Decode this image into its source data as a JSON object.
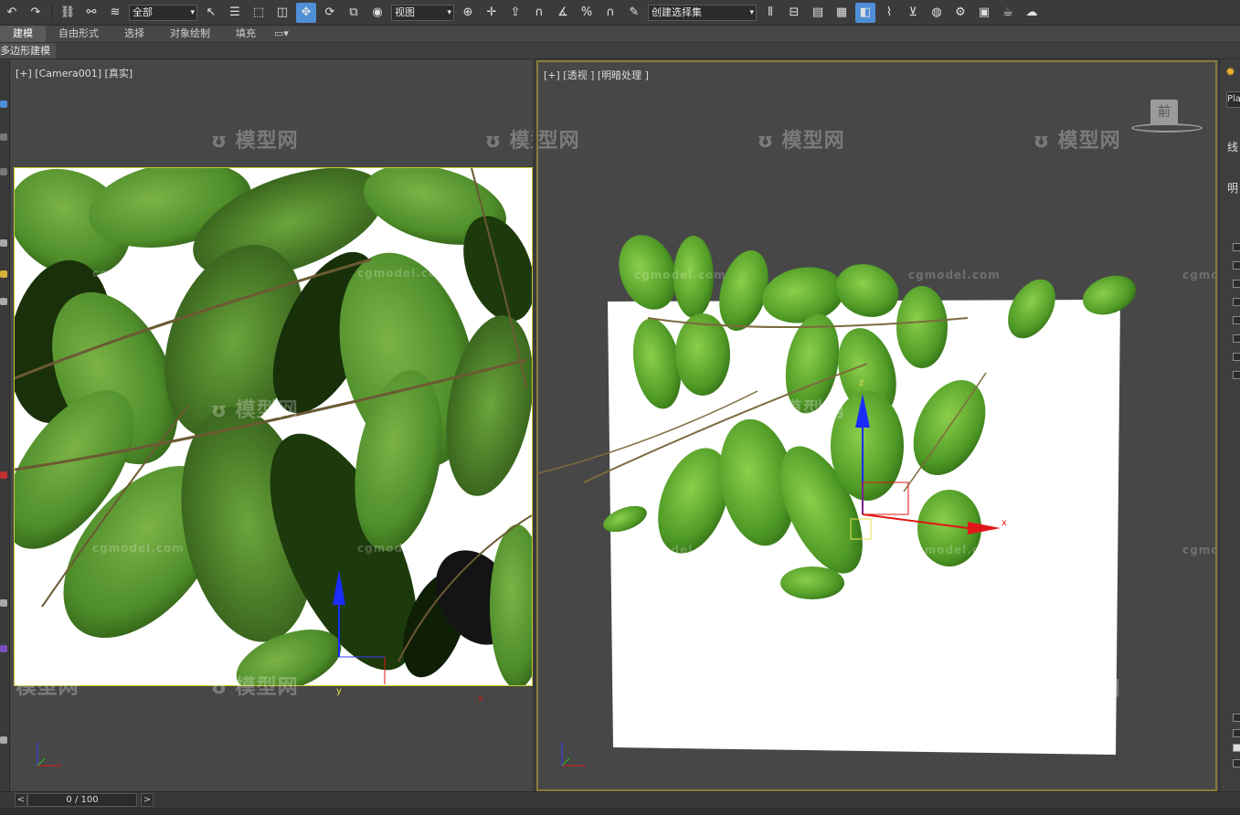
{
  "toolbar": {
    "selection_filter": "全部",
    "reference_coord": "视图",
    "named_selection": "创建选择集"
  },
  "ribbon": {
    "tabs": [
      "建模",
      "自由形式",
      "选择",
      "对象绘制",
      "填充"
    ]
  },
  "subbar": {
    "label": "多边形建模"
  },
  "viewports": {
    "left": {
      "label": "[+] [Camera001] [真实]"
    },
    "right": {
      "label": "[+] [透视 ] [明暗处理 ]"
    }
  },
  "viewcube": {
    "face_label": "前"
  },
  "watermarks": {
    "logo": "模型网",
    "url": "cgmodel.com"
  },
  "gizmo": {
    "x_label": "x",
    "y_label": "y",
    "z_label": "z"
  },
  "timeline": {
    "frame": "0 / 100",
    "prev": "<",
    "next": ">"
  },
  "right_panel": {
    "field_text": "Pla",
    "line1": "线",
    "line2": "明"
  },
  "colors": {
    "accent": "#4f8fd8",
    "leaf_green": "#4e8d2a",
    "active_viewport_border": "#c8c832",
    "gizmo_blue": "#1a2cff",
    "gizmo_red": "#e01616"
  }
}
